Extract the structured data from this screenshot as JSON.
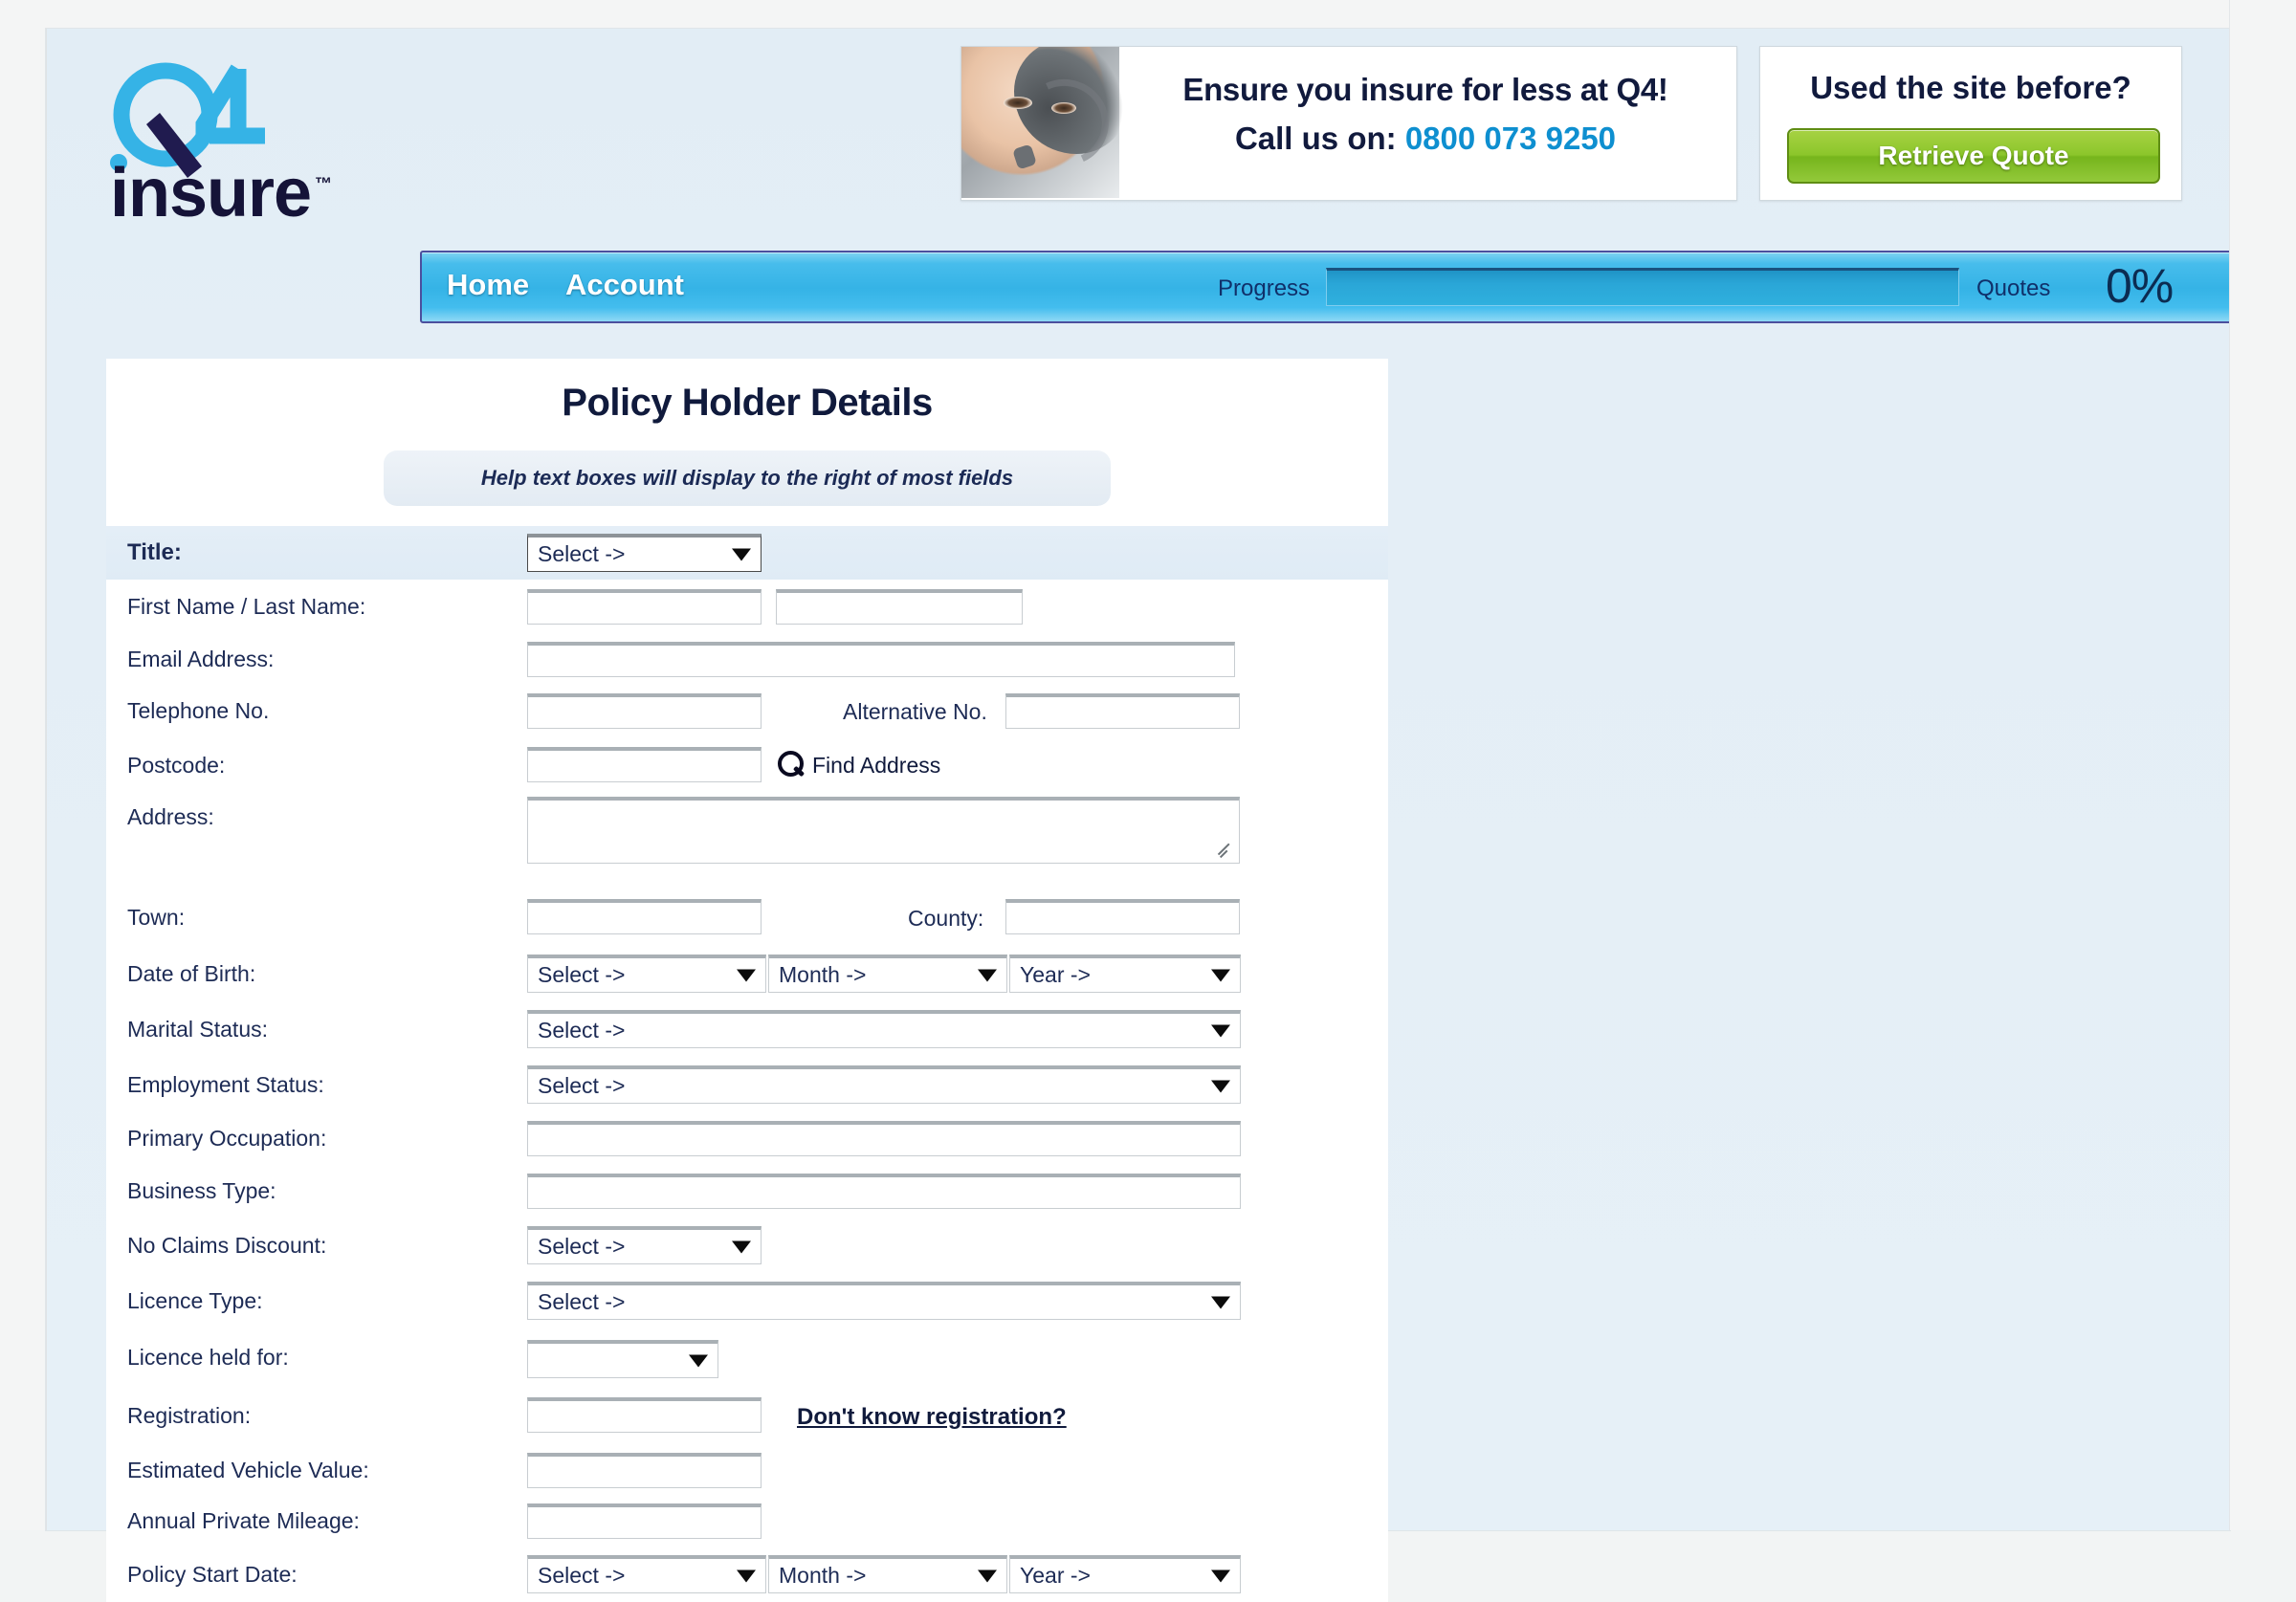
{
  "brand": {
    "logo_main": "Q4",
    "logo_sub": "insure",
    "logo_tm": "TM"
  },
  "nav": {
    "home": "Home",
    "account": "Account",
    "progress_label": "Progress",
    "quotes_label": "Quotes",
    "progress_percent": "0%",
    "progress_value": 0
  },
  "promo": {
    "line1": "Ensure you insure for less at Q4!",
    "call_prefix": "Call us on:",
    "phone": "0800 073 9250"
  },
  "retrieve": {
    "title": "Used the site before?",
    "button": "Retrieve Quote"
  },
  "panel": {
    "title": "Policy Holder Details",
    "help_text": "Help text boxes will display to the right of most fields"
  },
  "placeholders": {
    "select": "Select ->",
    "month": "Month ->",
    "year": "Year ->",
    "blank": ""
  },
  "form": {
    "rows": [
      {
        "label": "Title:",
        "bold": true,
        "highlight": true
      },
      {
        "label": "First Name / Last Name:"
      },
      {
        "label": "Email Address:"
      },
      {
        "label": "Telephone No.",
        "inline_label": "Alternative No."
      },
      {
        "label": "Postcode:",
        "action": "Find Address"
      },
      {
        "label": "Address:"
      },
      {
        "label": "Town:",
        "inline_label": "County:"
      },
      {
        "label": "Date of Birth:"
      },
      {
        "label": "Marital Status:"
      },
      {
        "label": "Employment Status:"
      },
      {
        "label": "Primary Occupation:"
      },
      {
        "label": "Business Type:"
      },
      {
        "label": "No Claims Discount:"
      },
      {
        "label": "Licence Type:"
      },
      {
        "label": "Licence held for:"
      },
      {
        "label": "Registration:",
        "action": "Don't know registration?"
      },
      {
        "label": "Estimated Vehicle Value:"
      },
      {
        "label": "Annual Private Mileage:"
      },
      {
        "label": "Policy Start Date:"
      }
    ]
  },
  "colors": {
    "brand_blue": "#35b3e6",
    "logo_blue": "#35b3e6",
    "navy": "#101a3c",
    "green_button": "#8cc62b",
    "phone_blue": "#0e8fd0",
    "page_bg": "#e4eef6"
  }
}
